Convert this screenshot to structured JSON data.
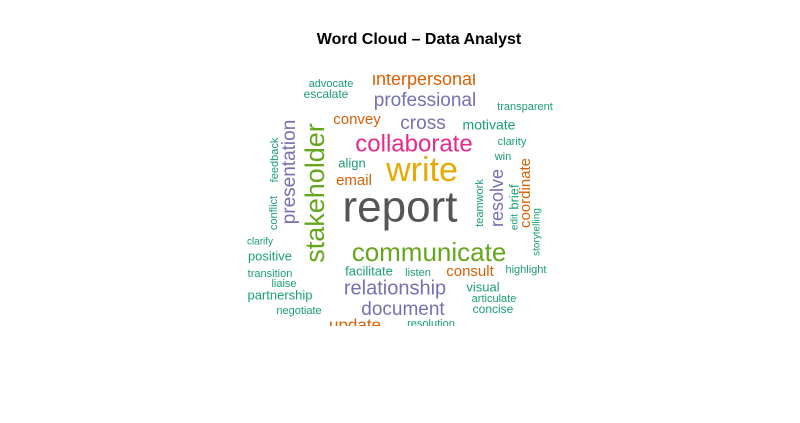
{
  "chart_data": {
    "type": "wordcloud",
    "title": "Word Cloud – Data Analyst",
    "palette": {
      "teal": "#1b9e77",
      "orange": "#d95f02",
      "purple": "#7570b3",
      "magenta": "#e7298a",
      "green": "#66a61e",
      "gold": "#e6ab02",
      "gray": "#555555"
    },
    "words": [
      {
        "text": "report",
        "color": "gray",
        "rotated": false
      },
      {
        "text": "write",
        "color": "gold",
        "rotated": false
      },
      {
        "text": "communicate",
        "color": "green",
        "rotated": false
      },
      {
        "text": "stakeholder",
        "color": "green",
        "rotated": true
      },
      {
        "text": "collaborate",
        "color": "magenta",
        "rotated": false
      },
      {
        "text": "relationship",
        "color": "purple",
        "rotated": false
      },
      {
        "text": "presentation",
        "color": "purple",
        "rotated": true
      },
      {
        "text": "professional",
        "color": "purple",
        "rotated": false
      },
      {
        "text": "document",
        "color": "purple",
        "rotated": false
      },
      {
        "text": "interpersonal",
        "color": "orange",
        "rotated": false
      },
      {
        "text": "cross",
        "color": "purple",
        "rotated": false
      },
      {
        "text": "resolve",
        "color": "purple",
        "rotated": true
      },
      {
        "text": "update",
        "color": "orange",
        "rotated": false
      },
      {
        "text": "coordinate",
        "color": "orange",
        "rotated": true
      },
      {
        "text": "convey",
        "color": "orange",
        "rotated": false
      },
      {
        "text": "email",
        "color": "orange",
        "rotated": false
      },
      {
        "text": "consult",
        "color": "orange",
        "rotated": false
      },
      {
        "text": "motivate",
        "color": "teal",
        "rotated": false
      },
      {
        "text": "facilitate",
        "color": "teal",
        "rotated": false
      },
      {
        "text": "align",
        "color": "teal",
        "rotated": false
      },
      {
        "text": "visual",
        "color": "teal",
        "rotated": false
      },
      {
        "text": "positive",
        "color": "teal",
        "rotated": false
      },
      {
        "text": "partnership",
        "color": "teal",
        "rotated": false
      },
      {
        "text": "brief",
        "color": "teal",
        "rotated": true
      },
      {
        "text": "concise",
        "color": "teal",
        "rotated": false
      },
      {
        "text": "escalate",
        "color": "teal",
        "rotated": false
      },
      {
        "text": "advocate",
        "color": "teal",
        "rotated": false
      },
      {
        "text": "transparent",
        "color": "teal",
        "rotated": false
      },
      {
        "text": "clarity",
        "color": "teal",
        "rotated": false
      },
      {
        "text": "win",
        "color": "teal",
        "rotated": false
      },
      {
        "text": "feedback",
        "color": "teal",
        "rotated": true
      },
      {
        "text": "conflict",
        "color": "teal",
        "rotated": true
      },
      {
        "text": "teamwork",
        "color": "teal",
        "rotated": true
      },
      {
        "text": "edit",
        "color": "teal",
        "rotated": true
      },
      {
        "text": "storytelling",
        "color": "teal",
        "rotated": true
      },
      {
        "text": "clarify",
        "color": "teal",
        "rotated": false
      },
      {
        "text": "transition",
        "color": "teal",
        "rotated": false
      },
      {
        "text": "liaise",
        "color": "teal",
        "rotated": false
      },
      {
        "text": "listen",
        "color": "teal",
        "rotated": false
      },
      {
        "text": "highlight",
        "color": "teal",
        "rotated": false
      },
      {
        "text": "articulate",
        "color": "teal",
        "rotated": false
      },
      {
        "text": "negotiate",
        "color": "teal",
        "rotated": false
      },
      {
        "text": "resolution",
        "color": "teal",
        "rotated": false
      }
    ]
  }
}
